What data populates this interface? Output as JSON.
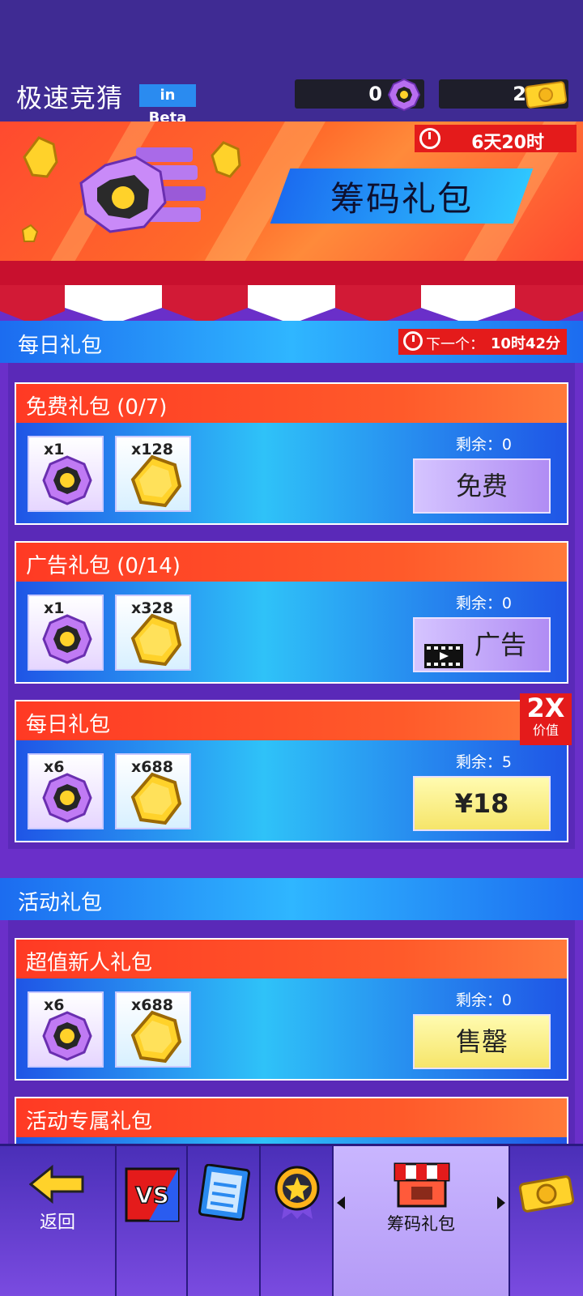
{
  "app": {
    "title": "极速竞猜",
    "beta_badge": "in Beta"
  },
  "currencies": [
    {
      "amount": "0",
      "icon": "chip-icon"
    },
    {
      "amount": "2",
      "icon": "ticket-icon"
    }
  ],
  "banner": {
    "timer": "6天20时",
    "title": "筹码礼包"
  },
  "daily_section": {
    "label": "每日礼包",
    "next_label": "下一个：",
    "next_value": "10时42分"
  },
  "packs": [
    {
      "title": "免费礼包 (0/7)",
      "chip_qty": "x1",
      "coin_qty": "x128",
      "remaining": "剩余：0",
      "action": "免费"
    },
    {
      "title": "广告礼包 (0/14)",
      "chip_qty": "x1",
      "coin_qty": "x328",
      "remaining": "剩余：0",
      "action": "广告"
    },
    {
      "title": "每日礼包",
      "chip_qty": "x6",
      "coin_qty": "x688",
      "remaining": "剩余：5",
      "action": "¥18",
      "badge_big": "2X",
      "badge_small": "价值"
    }
  ],
  "event_section": {
    "label": "活动礼包"
  },
  "event_packs": [
    {
      "title": "超值新人礼包",
      "chip_qty": "x6",
      "coin_qty": "x688",
      "remaining": "剩余：0",
      "action": "售罄"
    },
    {
      "title": "活动专属礼包"
    }
  ],
  "nav": {
    "back_label": "返回",
    "active_label": "筹码礼包",
    "items": [
      "back-icon",
      "vs-icon",
      "checklist-icon",
      "star-medal-icon",
      "shop-icon",
      "ticket-icon"
    ]
  },
  "colors": {
    "background": "#6a2fc9",
    "topbar": "#3f2b93",
    "card_header_red": "#ff3a24",
    "card_body_blue": "#2fc2f8",
    "timer_red": "#e41b1b",
    "button_yellow": "#f6e56a",
    "button_purple": "#b08cf4"
  }
}
